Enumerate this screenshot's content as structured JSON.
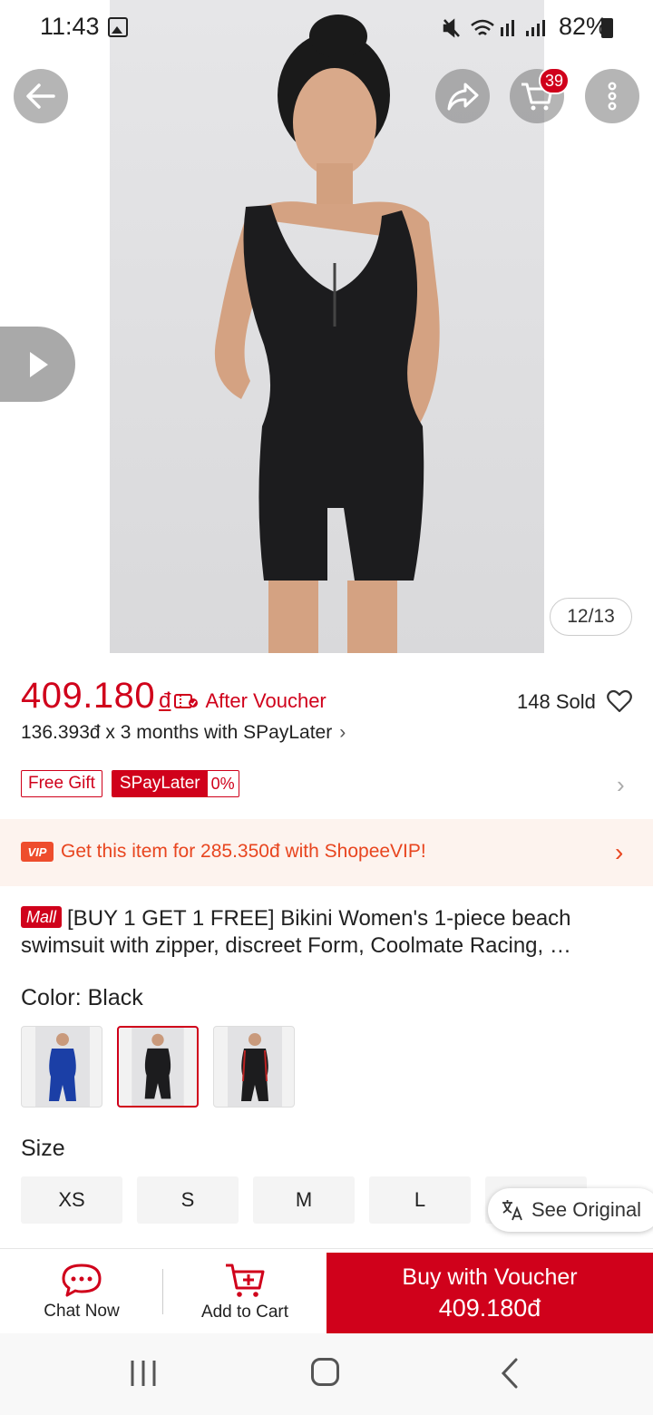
{
  "status_bar": {
    "time": "11:43",
    "battery": "82%"
  },
  "header": {
    "cart_count": "39"
  },
  "gallery": {
    "counter": "12/13"
  },
  "price": {
    "amount": "409.180",
    "currency": "đ",
    "after_voucher": "After Voucher",
    "sold": "148 Sold",
    "installment": "136.393đ x 3 months with SPayLater"
  },
  "tags": {
    "free_gift": "Free Gift",
    "spaylater": "SPayLater",
    "spaylater_rate": "0%"
  },
  "vip": {
    "badge": "VIP",
    "text": "Get this item for 285.350đ with ShopeeVIP!"
  },
  "product": {
    "mall_badge": "Mall",
    "title": "[BUY 1 GET 1 FREE] Bikini Women's 1-piece beach swimsuit with zipper, discreet Form, Coolmate Racing, …"
  },
  "variants": {
    "color_label": "Color: Black",
    "colors": [
      "Blue",
      "Black",
      "Black with red trim"
    ],
    "size_label": "Size",
    "sizes": [
      "XS",
      "S",
      "M",
      "L"
    ]
  },
  "translate": {
    "label": "See Original"
  },
  "bottom_bar": {
    "chat_now": "Chat Now",
    "add_to_cart": "Add to Cart",
    "buy_line1": "Buy with Voucher",
    "buy_line2": "409.180đ"
  },
  "colors": {
    "brand_red": "#d0011b",
    "vip_orange": "#e8451f"
  }
}
